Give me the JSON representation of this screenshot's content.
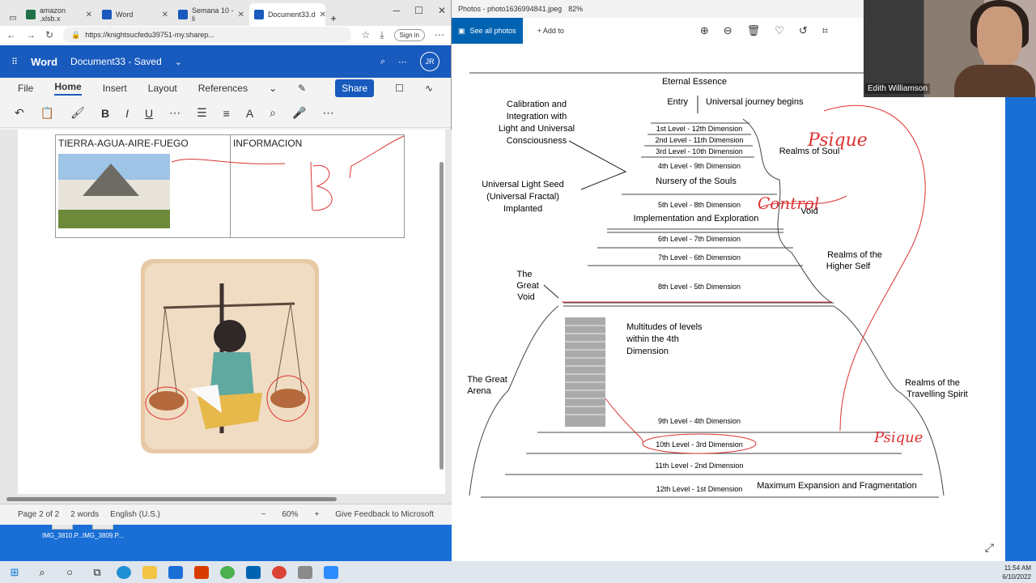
{
  "browser": {
    "tabs": [
      {
        "label": "amazon .xlsb.x",
        "color": "#1e7145"
      },
      {
        "label": "Word",
        "color": "#185abd"
      },
      {
        "label": "Semana 10 - li",
        "color": "#185abd"
      },
      {
        "label": "Document33.d",
        "color": "#185abd"
      }
    ],
    "url": "https://knightsucfedu39751-my.sharep...",
    "signin": "Sign in"
  },
  "word": {
    "app": "Word",
    "doc_title": "Document33 - Saved",
    "avatar": "JR",
    "ribbon_tabs": [
      "File",
      "Home",
      "Insert",
      "Layout",
      "References"
    ],
    "share": "Share",
    "table": {
      "col1": "TIERRA-AGUA-AIRE-FUEGO",
      "col2": "INFORMACION"
    },
    "status": {
      "page": "Page 2 of 2",
      "words": "2 words",
      "lang": "English (U.S.)",
      "zoom": "60%",
      "feedback": "Give Feedback to Microsoft"
    }
  },
  "desktop_icons": [
    "IMG_3810.P...",
    "IMG_3809.P..."
  ],
  "photos": {
    "title": "Photos - photo1636994841.jpeg",
    "zoom": "82%",
    "see_all": "See all photos",
    "add_to": "Add to",
    "edit": "Ed"
  },
  "diagram": {
    "eternal": "Eternal Essence",
    "entry": "Entry",
    "journey": "Universal journey begins",
    "calibration": [
      "Calibration and",
      "Integration with",
      "Light and Universal",
      "Consciousness"
    ],
    "seed": [
      "Universal Light Seed",
      "(Universal Fractal)",
      "Implanted"
    ],
    "levels": [
      "1st Level - 12th Dimension",
      "2nd Level - 11th Dimension",
      "3rd Level - 10th Dimension",
      "4th Level - 9th Dimension",
      "5th Level - 8th Dimension",
      "6th Level - 7th Dimension",
      "7th Level - 6th Dimension",
      "8th Level - 5th Dimension",
      "9th Level - 4th Dimension",
      "10th Level - 3rd Dimension",
      "11th Level - 2nd Dimension",
      "12th Level - 1st Dimension"
    ],
    "nursery": "Nursery of the Souls",
    "implementation": "Implementation and Exploration",
    "soul": "Realms of Soul",
    "void": "Void",
    "higher": [
      "Realms of the",
      "Higher Self"
    ],
    "great_void": [
      "The",
      "Great",
      "Void"
    ],
    "multitudes": [
      "Multitudes of levels",
      "within the 4th",
      "Dimension"
    ],
    "arena": [
      "The Great",
      "Arena"
    ],
    "travelling": [
      "Realms of the",
      "Travelling Spirit"
    ],
    "maximum": "Maximum Expansion and Fragmentation",
    "handwriting": [
      "Psique",
      "Control",
      "Psique"
    ]
  },
  "webcam": {
    "name": "Edith Williamson"
  },
  "clock": {
    "time": "11:54 AM",
    "date": "6/10/2022"
  }
}
